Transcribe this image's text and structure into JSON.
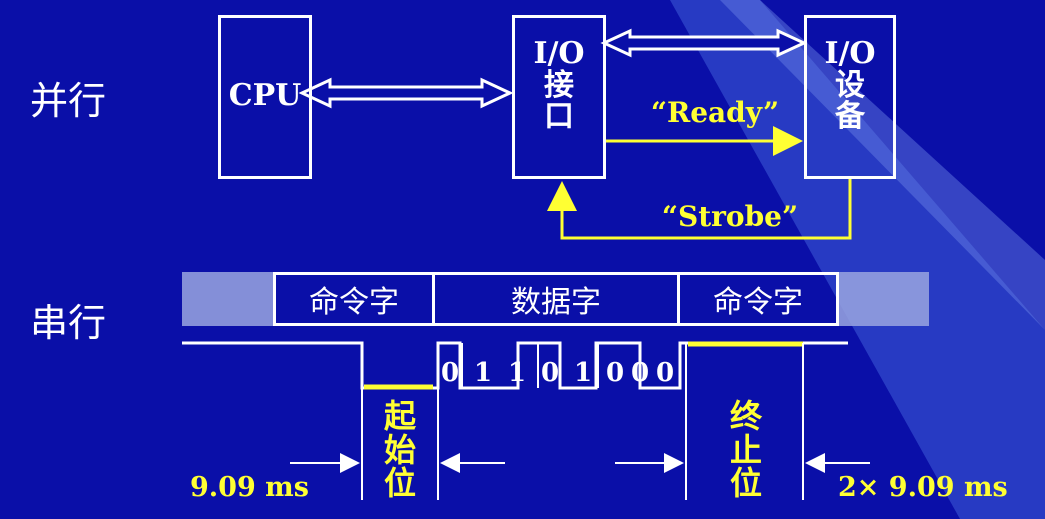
{
  "labels": {
    "parallel": "并行",
    "serial": "串行"
  },
  "parallel": {
    "cpu": "CPU",
    "io_interface": [
      "I/O",
      "接",
      "口"
    ],
    "io_device": [
      "I/O",
      "设",
      "备"
    ],
    "ready": "“Ready”",
    "strobe": "“Strobe”"
  },
  "serial": {
    "fields": [
      "命令字",
      "数据字",
      "命令字"
    ],
    "bits": [
      "0",
      "1",
      "1",
      "0",
      "1",
      "0",
      "0",
      "0"
    ],
    "start_bit": [
      "起",
      "始",
      "位"
    ],
    "stop_bit": [
      "终",
      "止",
      "位"
    ],
    "left_time": "9.09 ms",
    "right_time": "2× 9.09 ms"
  },
  "colors": {
    "background": "#0a0fa8",
    "highlight": "#ffff33",
    "line": "#ffffff",
    "shade": "#9aa6e0"
  }
}
